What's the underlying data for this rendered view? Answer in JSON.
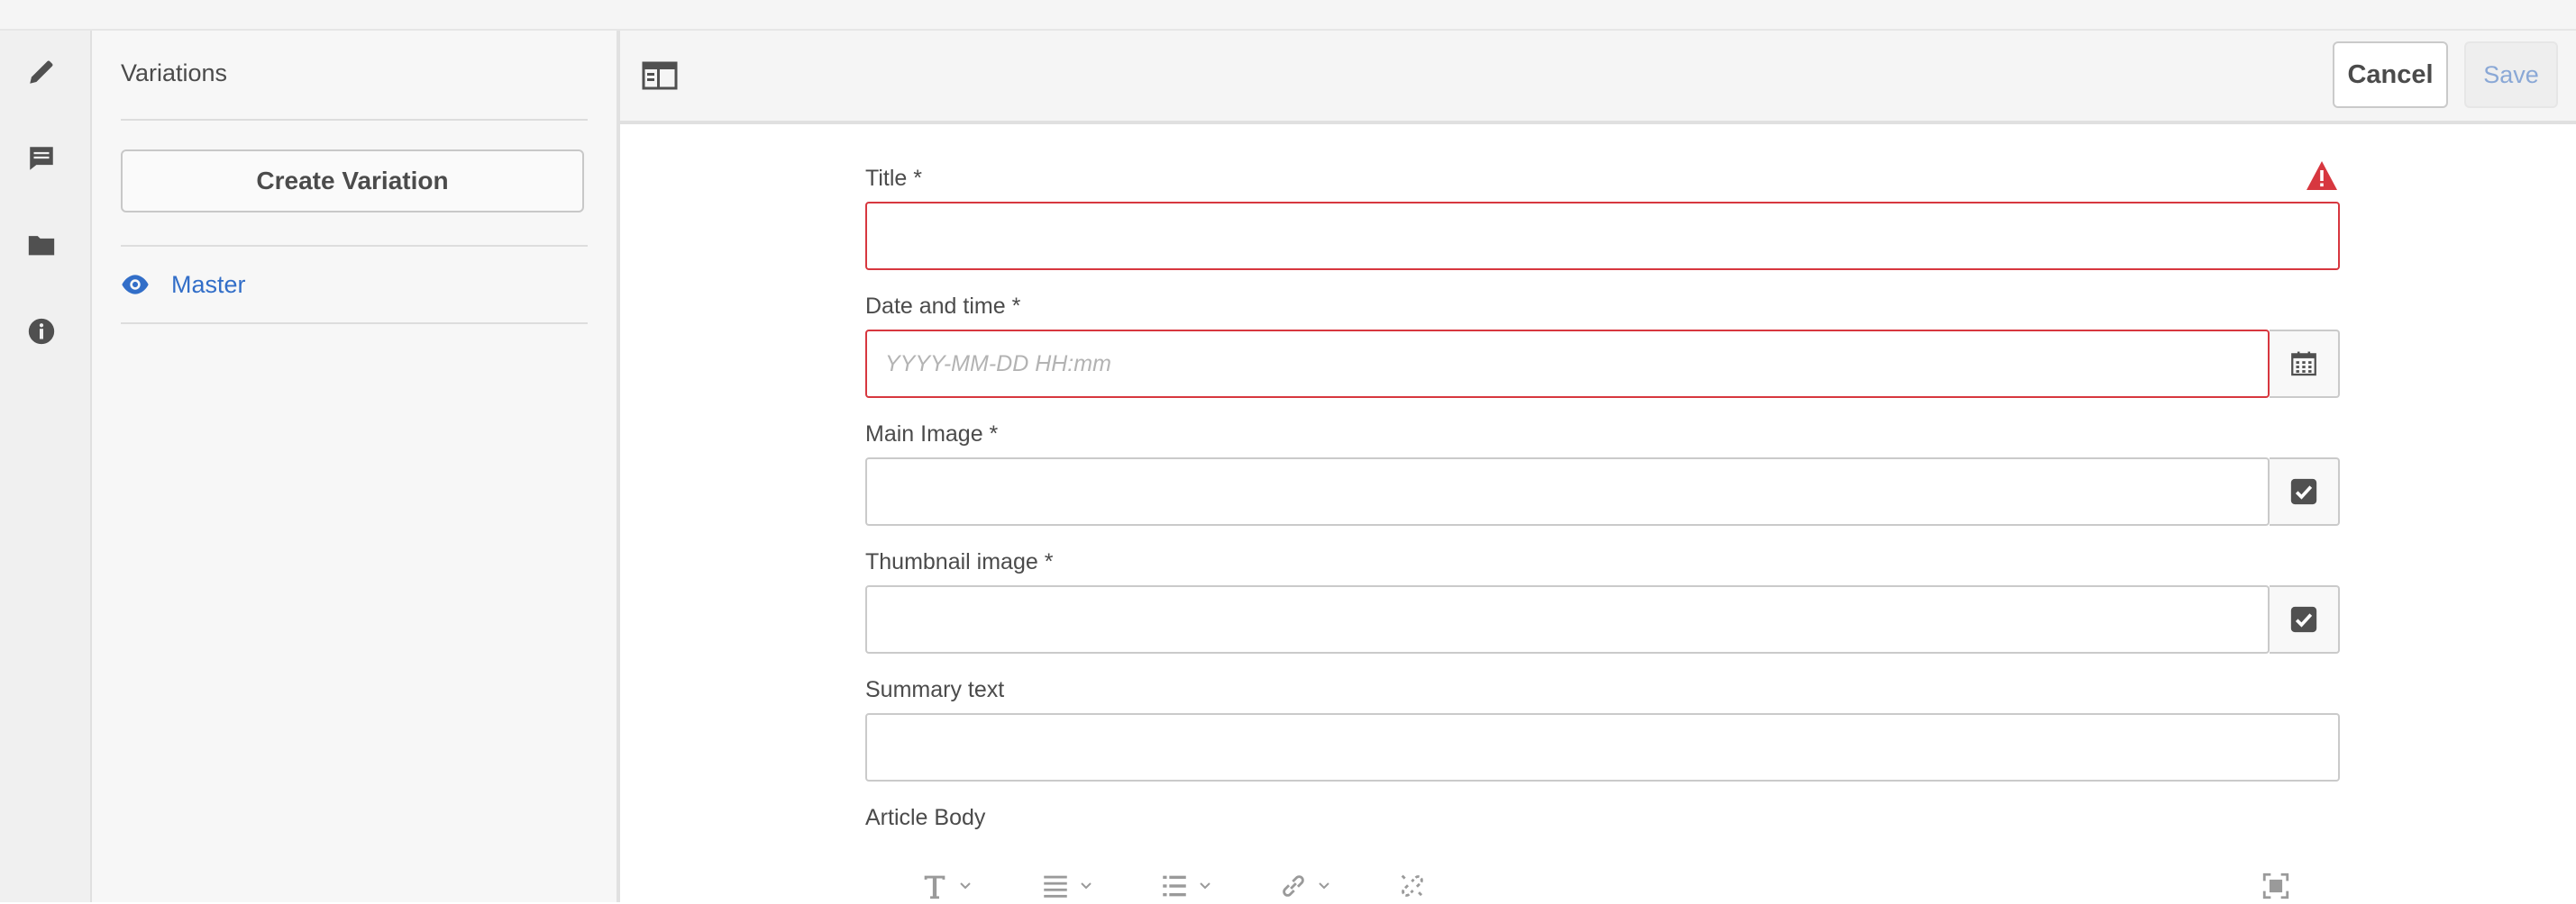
{
  "panel": {
    "title": "Variations",
    "create_button": "Create Variation",
    "master_label": "Master"
  },
  "rail": {
    "icons": [
      "pencil-icon",
      "comment-icon",
      "folder-icon",
      "info-icon"
    ]
  },
  "toolbar": {
    "cancel_label": "Cancel",
    "save_label": "Save"
  },
  "form": {
    "title_label": "Title *",
    "date_label": "Date and time *",
    "date_placeholder": "YYYY-MM-DD HH:mm",
    "main_image_label": "Main Image *",
    "thumbnail_label": "Thumbnail image *",
    "summary_label": "Summary text",
    "body_label": "Article Body"
  },
  "colors": {
    "error": "#d7373f",
    "accent": "#326ec8",
    "icon": "#505050"
  }
}
